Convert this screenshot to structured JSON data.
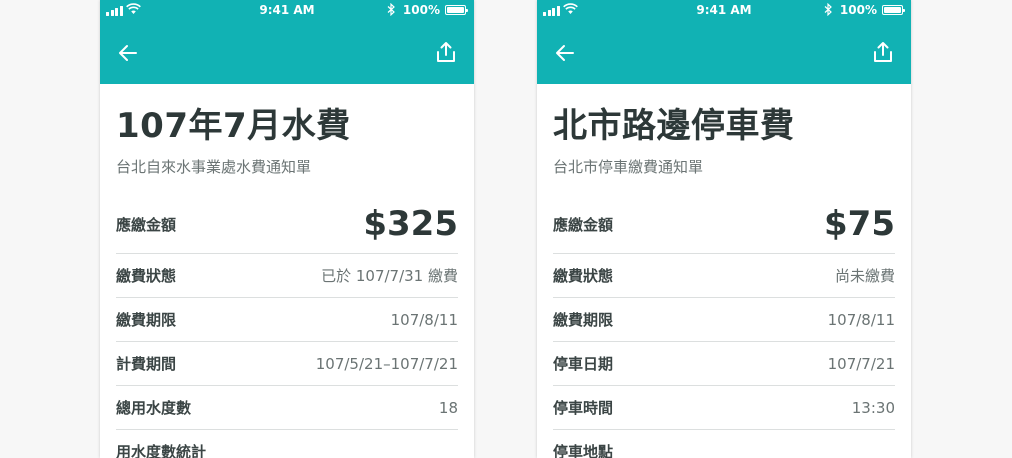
{
  "status_bar": {
    "time": "9:41 AM",
    "battery": "100%"
  },
  "bills": [
    {
      "title": "107年7月水費",
      "subtitle": "台北自來水事業處水費通知單",
      "amount_label": "應繳金額",
      "amount": "$325",
      "rows": [
        {
          "label": "繳費狀態",
          "value": "已於 107/7/31 繳費"
        },
        {
          "label": "繳費期限",
          "value": "107/8/11"
        },
        {
          "label": "計費期間",
          "value": "107/5/21–107/7/21"
        },
        {
          "label": "總用水度數",
          "value": "18"
        },
        {
          "label": "用水度數統計",
          "value": ""
        }
      ]
    },
    {
      "title": "北市路邊停車費",
      "subtitle": "台北市停車繳費通知單",
      "amount_label": "應繳金額",
      "amount": "$75",
      "rows": [
        {
          "label": "繳費狀態",
          "value": "尚未繳費"
        },
        {
          "label": "繳費期限",
          "value": "107/8/11"
        },
        {
          "label": "停車日期",
          "value": "107/7/21"
        },
        {
          "label": "停車時間",
          "value": "13:30"
        },
        {
          "label": "停車地點",
          "value": ""
        }
      ]
    }
  ],
  "icons": {
    "back": "arrow-left-icon",
    "share": "share-icon"
  },
  "colors": {
    "header": "#11b2b4",
    "title": "#2d3838",
    "secondary": "#6b7474",
    "divider": "#dcdfdf"
  }
}
